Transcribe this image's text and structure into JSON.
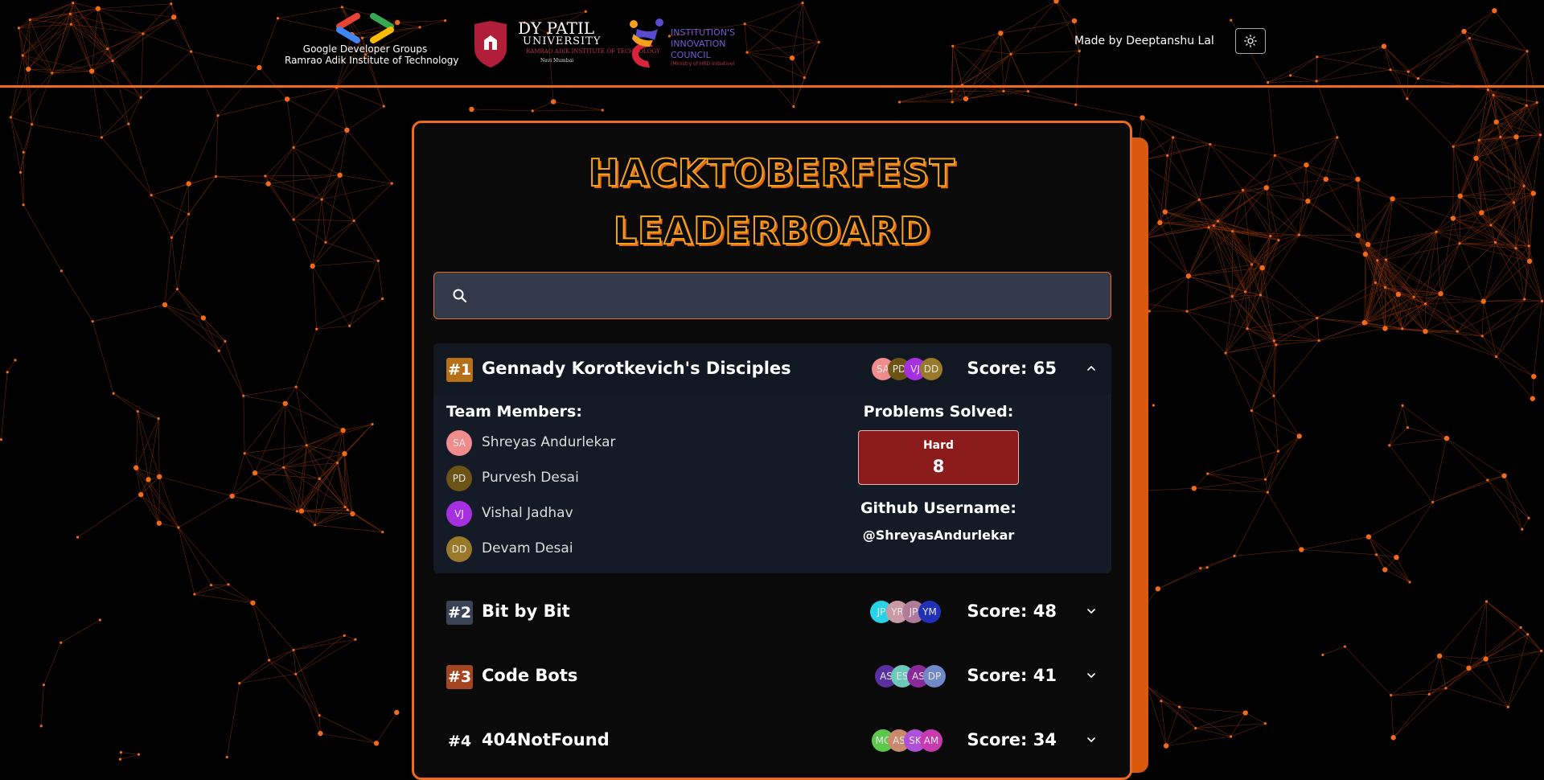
{
  "header": {
    "gdg_line1": "Google Developer Groups",
    "gdg_line2": "Ramrao Adik Institute of Technology",
    "dyp_name": "DY PATIL",
    "dyp_university": "UNIVERSITY",
    "dyp_sub": "RAMRAO ADIK INSTITUTE OF TECHNOLOGY",
    "dyp_location": "Navi Mumbai",
    "iic_text": "INSTITUTION'S\nINNOVATION\nCOUNCIL",
    "iic_sub": "(Ministry of HRD Initiative)",
    "made_by": "Made by Deeptanshu Lal",
    "theme_toggle_icon": "sun-icon"
  },
  "title": {
    "line1": "HACKTOBERFEST",
    "line2": "LEADERBOARD"
  },
  "search": {
    "placeholder": "",
    "value": "",
    "icon": "search-icon"
  },
  "colors": {
    "accent": "#f06a1a",
    "card_background": "#0a0a0a",
    "search_background": "#323a49",
    "hard_background": "#8c1c1c",
    "expanded_background": "#141b26"
  },
  "teams": [
    {
      "rank": "#1",
      "rank_color": "#b6701a",
      "name": "Gennady Korotkevich's Disciples",
      "avatars": [
        {
          "initials": "SA",
          "color": "#f08c8c"
        },
        {
          "initials": "PD",
          "color": "#6b5416"
        },
        {
          "initials": "VJ",
          "color": "#a630e0"
        },
        {
          "initials": "DD",
          "color": "#9a7a2a"
        }
      ],
      "score": "Score: 65",
      "expanded": true,
      "chevron": "chevron-up-icon",
      "members_title": "Team Members:",
      "members": [
        {
          "initials": "SA",
          "name": "Shreyas Andurlekar",
          "color": "#f08c8c"
        },
        {
          "initials": "PD",
          "name": "Purvesh Desai",
          "color": "#6b5416"
        },
        {
          "initials": "VJ",
          "name": "Vishal Jadhav",
          "color": "#a630e0"
        },
        {
          "initials": "DD",
          "name": "Devam Desai",
          "color": "#9a7a2a"
        }
      ],
      "problems_title": "Problems Solved:",
      "hard_label": "Hard",
      "hard_value": "8",
      "github_title": "Github Username:",
      "github_user": "@ShreyasAndurlekar"
    },
    {
      "rank": "#2",
      "rank_color": "#3a4356",
      "name": "Bit by Bit",
      "avatars": [
        {
          "initials": "JP",
          "color": "#27d3e6"
        },
        {
          "initials": "YR",
          "color": "#c99aa4"
        },
        {
          "initials": "JP",
          "color": "#b07a9a"
        },
        {
          "initials": "YM",
          "color": "#2230b8"
        }
      ],
      "score": "Score: 48",
      "expanded": false,
      "chevron": "chevron-down-icon"
    },
    {
      "rank": "#3",
      "rank_color": "#a24520",
      "name": "Code Bots",
      "avatars": [
        {
          "initials": "AS",
          "color": "#5a30a0"
        },
        {
          "initials": "ES",
          "color": "#6cc8b8"
        },
        {
          "initials": "AS",
          "color": "#8a2a9a"
        },
        {
          "initials": "DP",
          "color": "#7088c8"
        }
      ],
      "score": "Score: 41",
      "expanded": false,
      "chevron": "chevron-down-icon"
    },
    {
      "rank": "#4",
      "rank_color": "transparent",
      "name": "404NotFound",
      "avatars": [
        {
          "initials": "MC",
          "color": "#5cc84a"
        },
        {
          "initials": "AS",
          "color": "#c88a6a"
        },
        {
          "initials": "SK",
          "color": "#b050d8"
        },
        {
          "initials": "AM",
          "color": "#c83ab0"
        }
      ],
      "score": "Score: 34",
      "expanded": false,
      "chevron": "chevron-down-icon"
    }
  ]
}
